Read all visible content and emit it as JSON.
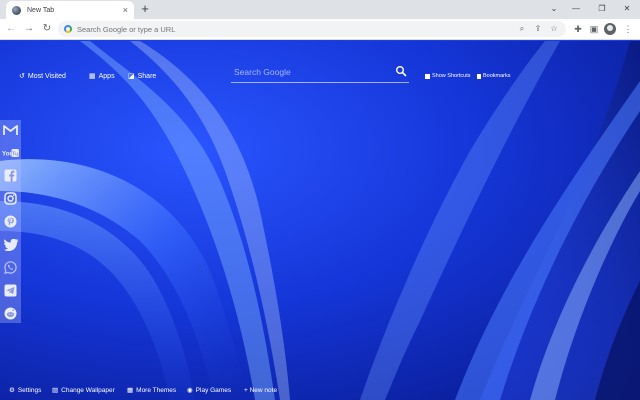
{
  "browser": {
    "tab_title": "New Tab",
    "tab_close": "×",
    "new_tab": "+",
    "omnibox_placeholder": "Search Google or type a URL"
  },
  "topnav": {
    "most_visited": "Most Visited",
    "apps": "Apps",
    "share": "Share"
  },
  "search": {
    "placeholder": "Search Google"
  },
  "rightlinks": {
    "show_shortcuts": "Show Shortcuts",
    "bookmarks": "Bookmarks"
  },
  "social": [
    "gmail-icon",
    "youtube-icon",
    "facebook-icon",
    "instagram-icon",
    "pinterest-icon",
    "twitter-icon",
    "whatsapp-icon",
    "telegram-icon",
    "reddit-icon"
  ],
  "bottombar": {
    "settings": "Settings",
    "change_wallpaper": "Change Wallpaper",
    "more_themes": "More Themes",
    "play_games": "Play Games",
    "new_note": "+ New note"
  },
  "colors": {
    "wallpaper_base": "#1b3fe0",
    "wallpaper_highlight": "#7fb2ff",
    "wallpaper_dark": "#081670"
  }
}
